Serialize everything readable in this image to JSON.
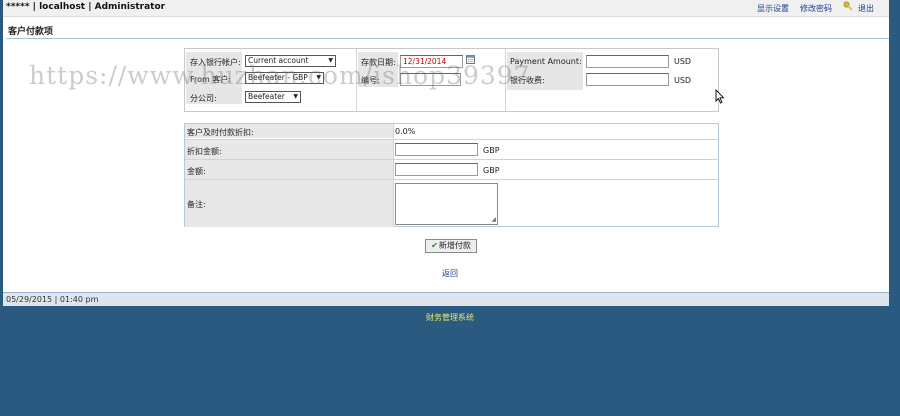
{
  "header": {
    "title": "***** | localhost | Administrator",
    "links": {
      "display_settings": "显示设置",
      "change_password": "修改密码",
      "logout": "退出"
    }
  },
  "page": {
    "title": "客户付款项"
  },
  "form": {
    "deposit_account_label": "存入银行帐户:",
    "deposit_account_value": "Current account",
    "from_label": "From 客户:",
    "from_value": "Beefeater - GBP",
    "branch_label": "分公司:",
    "branch_value": "Beefeater",
    "date_label": "存款日期:",
    "date_value": "12/31/2014",
    "ref_label": "编号:",
    "payment_amount_label": "Payment Amount:",
    "payment_amount_value": "",
    "payment_currency": "USD",
    "bank_charge_label": "银行收费:",
    "bank_charge_value": "",
    "bank_charge_currency": "USD"
  },
  "details": {
    "discount_rate_label": "客户及时付款折扣:",
    "discount_rate_value": "0.0%",
    "discount_amount_label": "折扣金额:",
    "discount_amount_currency": "GBP",
    "amount_label": "金额:",
    "amount_currency": "GBP",
    "memo_label": "备注:"
  },
  "actions": {
    "add_button": "新增付款",
    "back_link": "返回"
  },
  "status": {
    "datetime": "05/29/2015 | 01:40 pm"
  },
  "footer": {
    "text": "财务管理系统"
  },
  "watermark": {
    "text": "https://www.huzhan.com/ishop39397"
  },
  "colors": {
    "background": "#2a5a80",
    "link": "#1a3d8f",
    "date_text": "#c00000",
    "footer_text": "#e8e870"
  },
  "icons": [
    "calendar-icon",
    "key-icon",
    "check-icon",
    "mouse-cursor-icon"
  ]
}
